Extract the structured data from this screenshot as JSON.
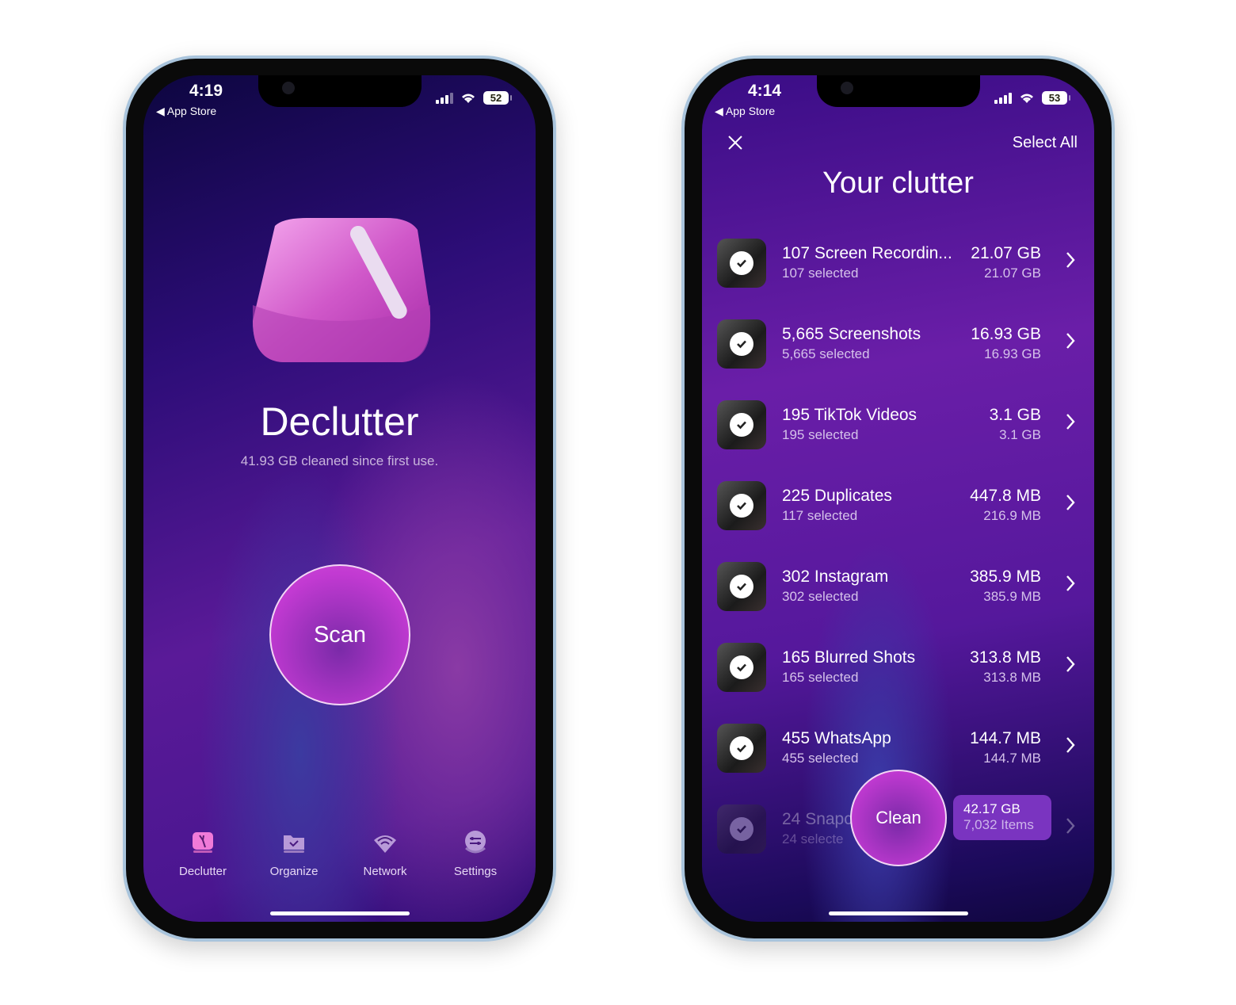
{
  "left_phone": {
    "status": {
      "time": "4:19",
      "back": "App Store",
      "battery": "52"
    },
    "title": "Declutter",
    "subtitle": "41.93 GB cleaned since first use.",
    "scan_label": "Scan",
    "tabs": [
      {
        "label": "Declutter",
        "icon": "declutter-icon",
        "active": true
      },
      {
        "label": "Organize",
        "icon": "folder-check-icon"
      },
      {
        "label": "Network",
        "icon": "wifi-icon"
      },
      {
        "label": "Settings",
        "icon": "sliders-icon"
      }
    ]
  },
  "right_phone": {
    "status": {
      "time": "4:14",
      "back": "App Store",
      "battery": "53"
    },
    "select_all": "Select All",
    "title": "Your clutter",
    "items": [
      {
        "title": "107 Screen Recordin...",
        "selected": "107 selected",
        "size": "21.07 GB",
        "selected_size": "21.07 GB"
      },
      {
        "title": "5,665 Screenshots",
        "selected": "5,665 selected",
        "size": "16.93 GB",
        "selected_size": "16.93 GB"
      },
      {
        "title": "195 TikTok Videos",
        "selected": "195 selected",
        "size": "3.1 GB",
        "selected_size": "3.1 GB"
      },
      {
        "title": "225 Duplicates",
        "selected": "117 selected",
        "size": "447.8 MB",
        "selected_size": "216.9 MB"
      },
      {
        "title": "302 Instagram",
        "selected": "302 selected",
        "size": "385.9 MB",
        "selected_size": "385.9 MB"
      },
      {
        "title": "165 Blurred Shots",
        "selected": "165 selected",
        "size": "313.8 MB",
        "selected_size": "313.8 MB"
      },
      {
        "title": "455 WhatsApp",
        "selected": "455 selected",
        "size": "144.7 MB",
        "selected_size": "144.7 MB"
      },
      {
        "title": "24 Snapc",
        "selected": "24 selecte",
        "size": "",
        "selected_size": ""
      }
    ],
    "clean_label": "Clean",
    "summary": {
      "total": "42.17 GB",
      "items": "7,032 Items"
    }
  },
  "colors": {
    "accent": "#c238d6",
    "summary_bg": "#7a34c0"
  }
}
